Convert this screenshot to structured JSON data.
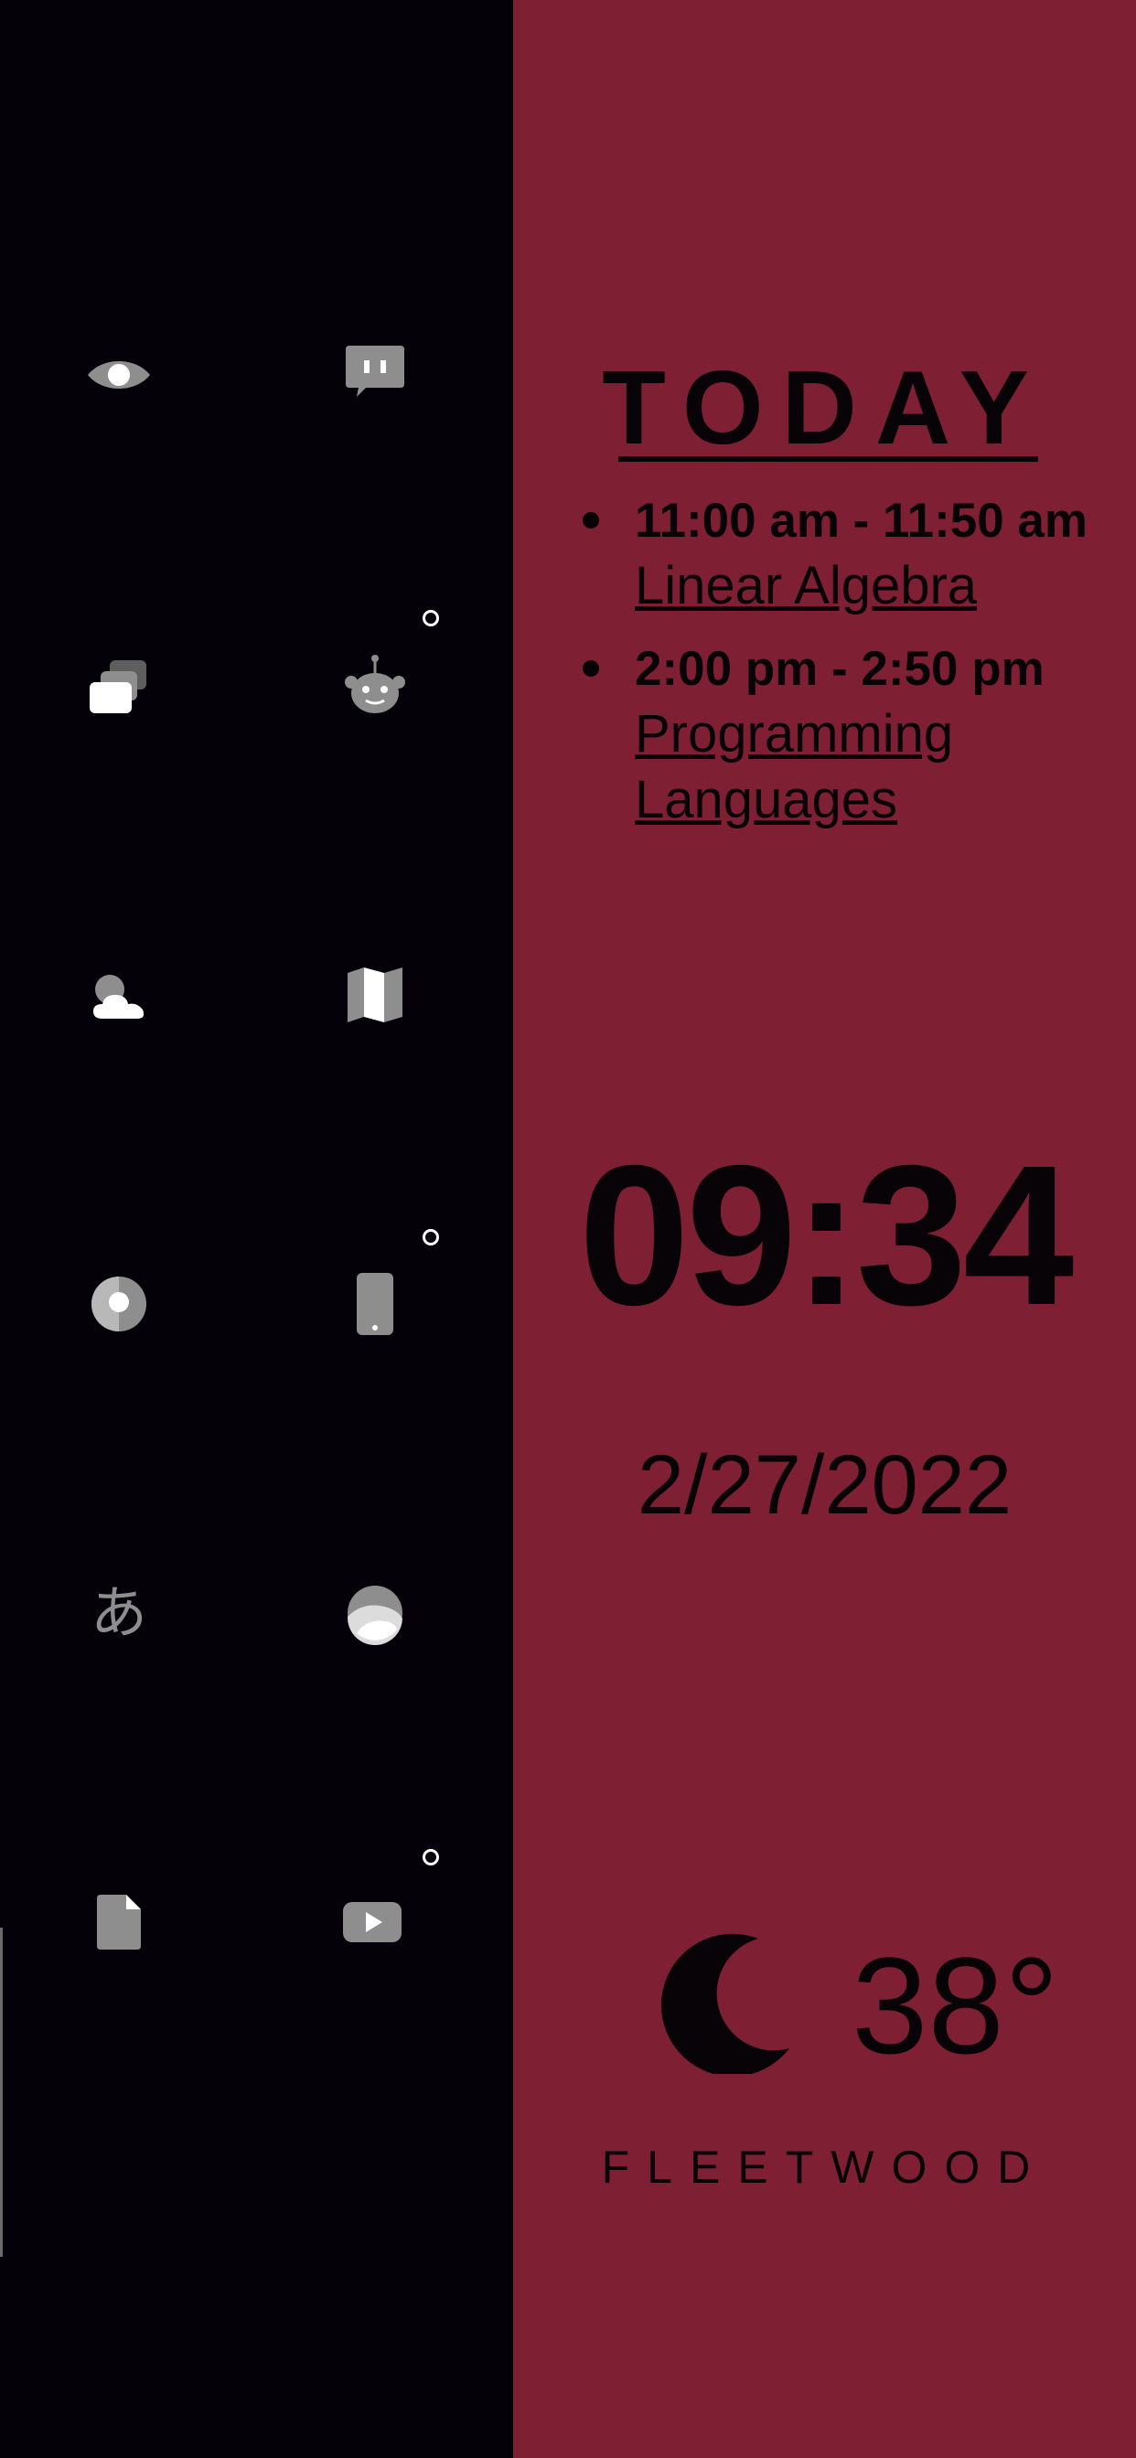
{
  "colors": {
    "left_background": "#040208",
    "right_background": "#7f1f34",
    "text": "#070306",
    "icon_gray": "#8e8e8e",
    "icon_white": "#ffffff"
  },
  "app_grid": [
    {
      "icon": "eye-icon"
    },
    {
      "icon": "chat-bubble-icon"
    },
    {
      "icon": "cards-icon"
    },
    {
      "icon": "reddit-robot-icon",
      "has_notification": true
    },
    {
      "icon": "cloud-weather-icon"
    },
    {
      "icon": "map-icon"
    },
    {
      "icon": "circle-app-icon"
    },
    {
      "icon": "phone-icon",
      "has_notification": true
    },
    {
      "icon": "hiragana-icon",
      "glyph": "あ"
    },
    {
      "icon": "planet-icon"
    },
    {
      "icon": "document-icon"
    },
    {
      "icon": "youtube-play-icon",
      "has_notification": true
    }
  ],
  "today": {
    "title": "TODAY",
    "events": [
      {
        "time": "11:00 am - 11:50 am",
        "name": "Linear Algebra"
      },
      {
        "time": "2:00 pm - 2:50 pm",
        "name": "Programming Languages"
      }
    ]
  },
  "clock": {
    "time": "09:34",
    "date": "2/27/2022"
  },
  "weather": {
    "icon": "moon-icon",
    "temperature": "38°",
    "location": "FLEETWOOD"
  }
}
